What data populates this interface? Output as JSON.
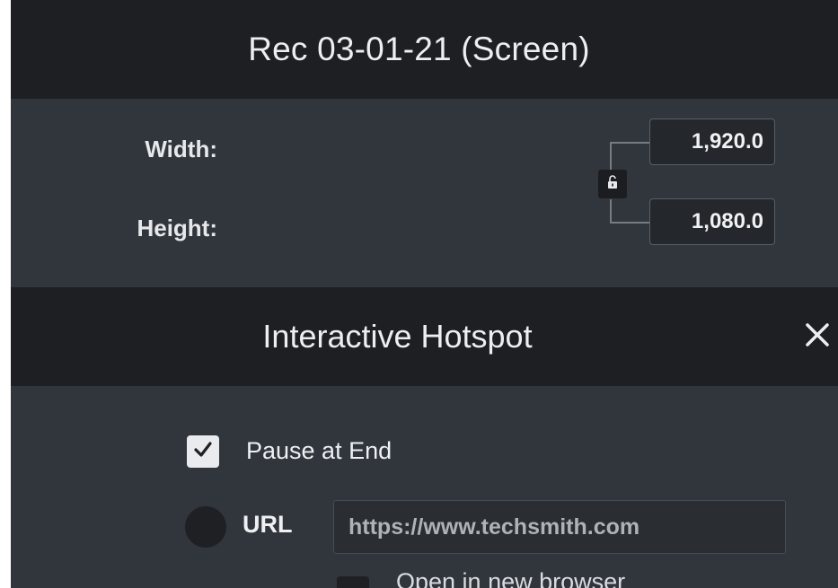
{
  "title_bar": {
    "title": "Rec 03-01-21 (Screen)"
  },
  "dimensions": {
    "width_label": "Width:",
    "height_label": "Height:",
    "width_value": "1,920.0",
    "height_value": "1,080.0",
    "lock_icon": "unlocked-padlock-icon"
  },
  "hotspot": {
    "title": "Interactive Hotspot",
    "close_icon": "close-icon",
    "pause_label": "Pause at End",
    "pause_checked": true,
    "url_label": "URL",
    "url_value": "https://www.techsmith.com",
    "new_browser_label": "Open in new browser"
  },
  "colors": {
    "panel_dark": "#1d1f23",
    "panel": "#31353c",
    "text": "#eceef0"
  }
}
